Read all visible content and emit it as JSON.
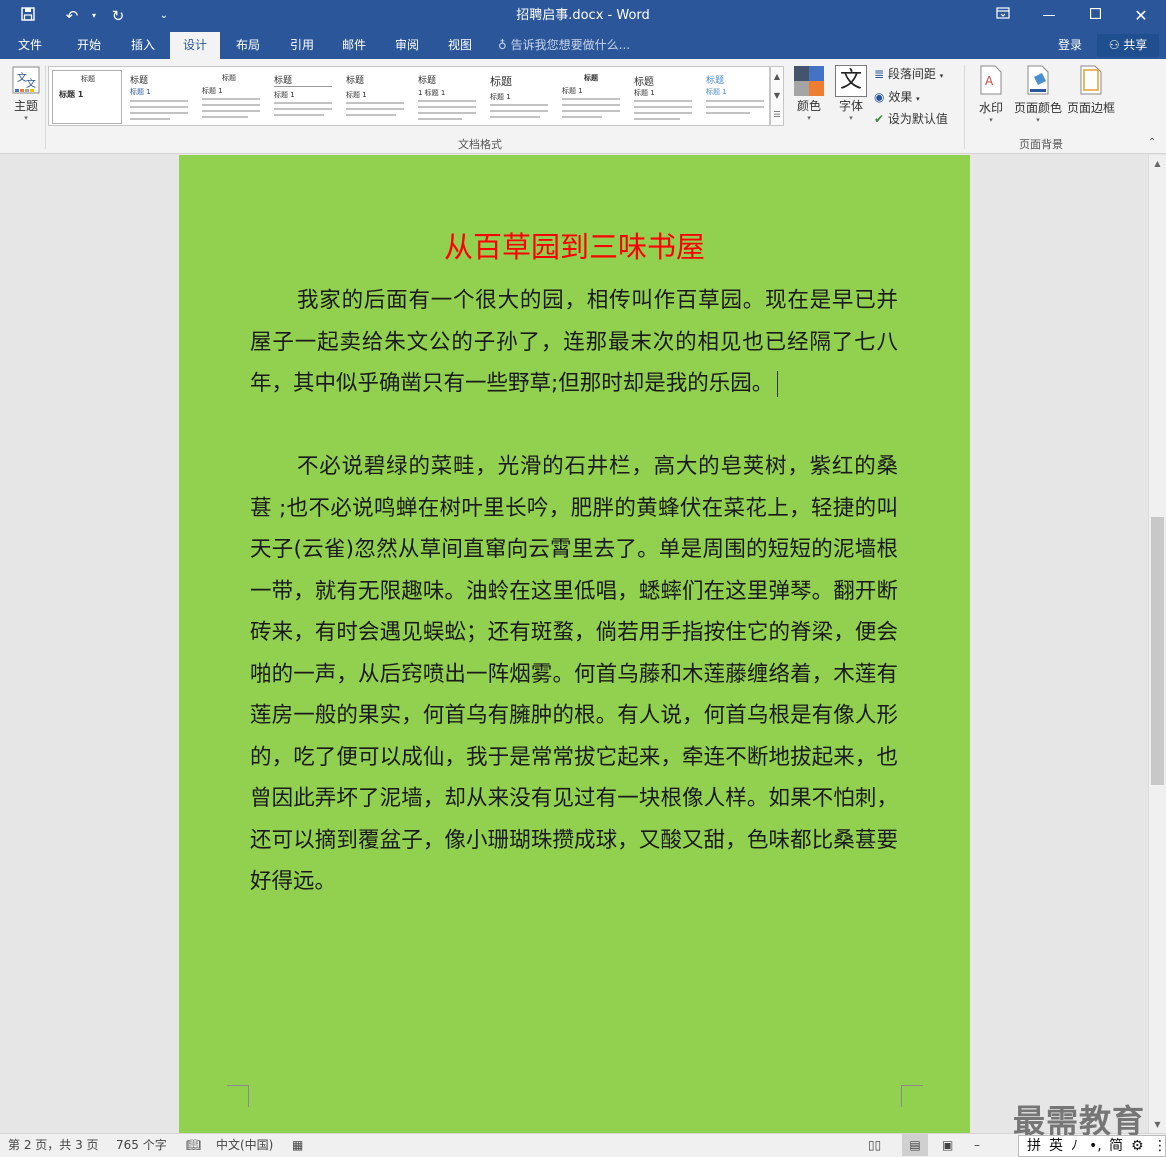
{
  "window": {
    "title": "招聘启事.docx - Word"
  },
  "tabs": [
    {
      "label": "文件",
      "active": false
    },
    {
      "label": "开始",
      "active": false
    },
    {
      "label": "插入",
      "active": false
    },
    {
      "label": "设计",
      "active": true
    },
    {
      "label": "布局",
      "active": false
    },
    {
      "label": "引用",
      "active": false
    },
    {
      "label": "邮件",
      "active": false
    },
    {
      "label": "审阅",
      "active": false
    },
    {
      "label": "视图",
      "active": false
    }
  ],
  "tell_me": "告诉我您想要做什么...",
  "account": {
    "login": "登录",
    "share": "共享"
  },
  "ribbon": {
    "theme_label": "主题",
    "gallery_thumbs": [
      {
        "heading": "标题  1",
        "sub": "标题"
      },
      {
        "heading": "标题",
        "sub": "标题 1"
      },
      {
        "heading": "标题",
        "sub": "标题 1"
      },
      {
        "heading": "标题",
        "sub": "标题 1"
      },
      {
        "heading": "标题",
        "sub": "标题 1"
      },
      {
        "heading": "标题",
        "sub": "1 标题 1"
      },
      {
        "heading": "标题",
        "sub": "标题 1"
      },
      {
        "heading": "标题",
        "sub": "标题 1"
      },
      {
        "heading": "标题",
        "sub": "标题 1"
      },
      {
        "heading": "标题",
        "sub": "标题 1"
      }
    ],
    "doc_format_label": "文档格式",
    "colors_label": "颜色",
    "fonts_label": "字体",
    "fonts_glyph": "文",
    "paragraph_spacing": "段落间距",
    "effects": "效果",
    "set_default": "设为默认值",
    "watermark": "水印",
    "page_color": "页面颜色",
    "page_borders": "页面边框",
    "page_background_label": "页面背景"
  },
  "document": {
    "title": "从百草园到三味书屋",
    "paragraphs": [
      "我家的后面有一个很大的园，相传叫作百草园。现在是早已并屋子一起卖给朱文公的子孙了，连那最末次的相见也已经隔了七八年，其中似乎确凿只有一些野草;但那时却是我的乐园。",
      "不必说碧绿的菜畦，光滑的石井栏，高大的皂荚树，紫红的桑葚 ;也不必说鸣蝉在树叶里长吟，肥胖的黄蜂伏在菜花上，轻捷的叫天子(云雀)忽然从草间直窜向云霄里去了。单是周围的短短的泥墙根一带，就有无限趣味。油蛉在这里低唱，蟋蟀们在这里弹琴。翻开断砖来，有时会遇见蜈蚣；还有斑蝥，倘若用手指按住它的脊梁，便会啪的一声，从后窍喷出一阵烟雾。何首乌藤和木莲藤缠络着，木莲有莲房一般的果实，何首乌有臃肿的根。有人说，何首乌根是有像人形的，吃了便可以成仙，我于是常常拔它起来，牵连不断地拔起来，也曾因此弄坏了泥墙，却从来没有见过有一块根像人样。如果不怕刺，还可以摘到覆盆子，像小珊瑚珠攒成球，又酸又甜，色味都比桑葚要好得远。"
    ],
    "page_color": "#92d050",
    "title_color": "#ff0000"
  },
  "status": {
    "page": "第 2 页，共 3 页",
    "words": "765 个字",
    "language": "中文(中国)"
  },
  "ime": {
    "items": [
      "拼",
      "英",
      "ﾉ",
      "•,",
      "简",
      "⚙",
      "⋮"
    ]
  },
  "watermark_text": "最需教育"
}
